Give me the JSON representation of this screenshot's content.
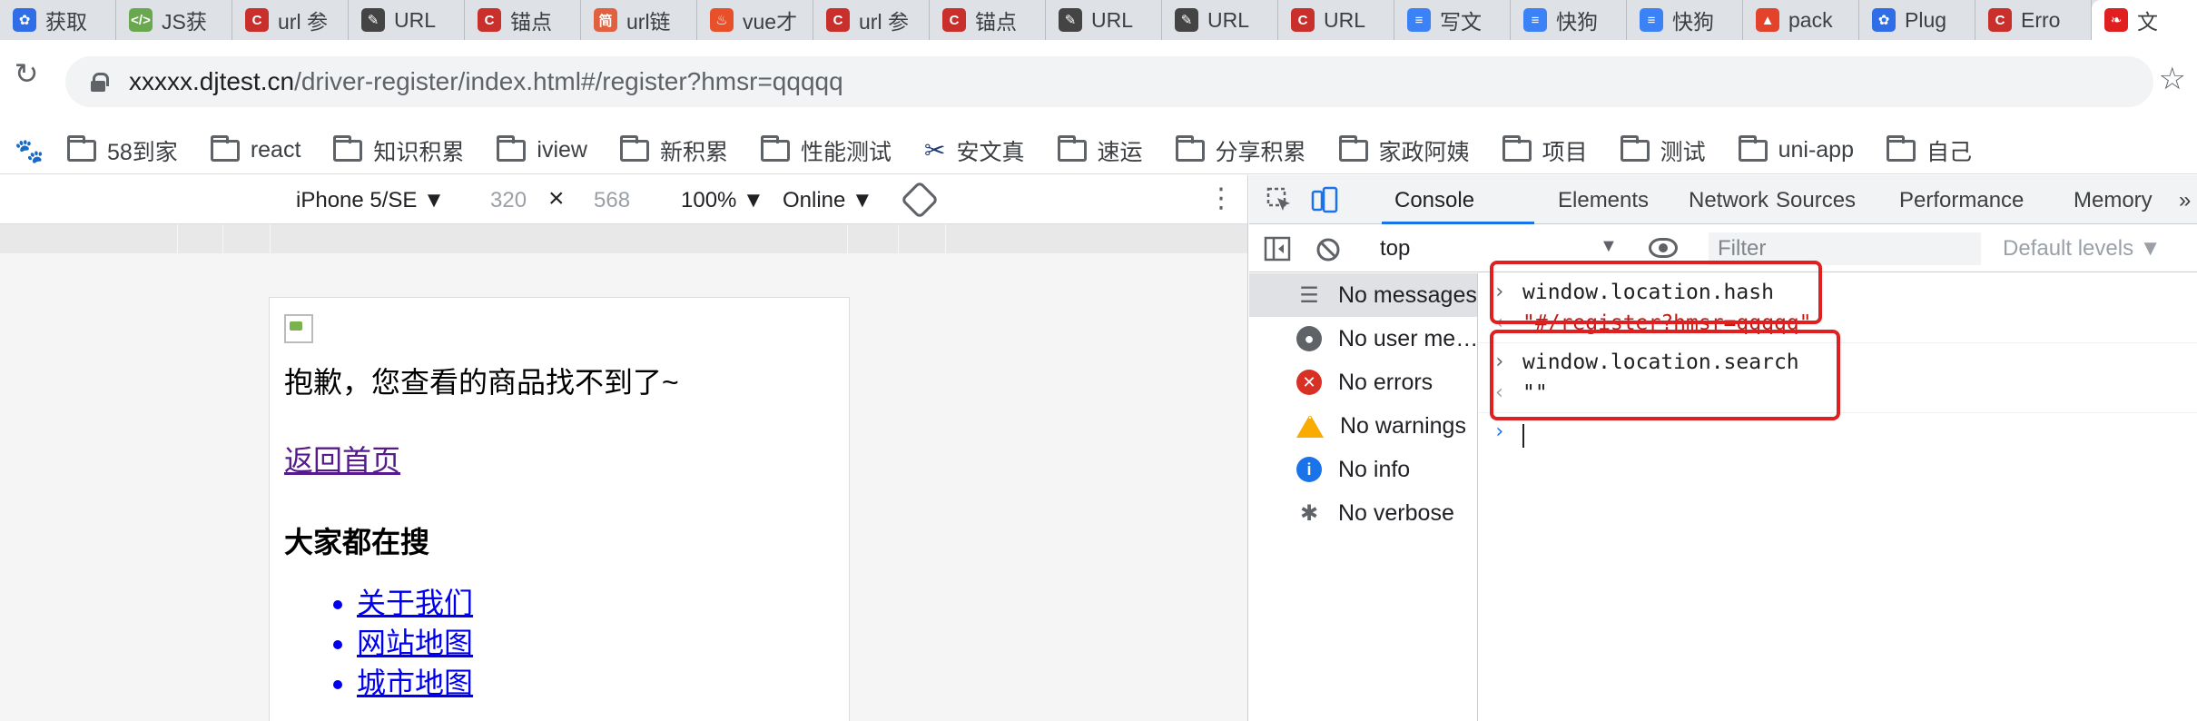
{
  "tabs": [
    {
      "title": "获取",
      "icon": "paw-icon",
      "color": "#2f6ee6"
    },
    {
      "title": "JS获",
      "icon": "code-icon",
      "color": "#6aa84f"
    },
    {
      "title": "url 参",
      "icon": "c-icon",
      "color": "#c9302c"
    },
    {
      "title": "URL",
      "icon": "pen-icon",
      "color": "#444444"
    },
    {
      "title": "锚点",
      "icon": "c-icon",
      "color": "#c9302c"
    },
    {
      "title": "url链",
      "icon": "jian-icon",
      "color": "#e06040"
    },
    {
      "title": "vue才",
      "icon": "flame-icon",
      "color": "#e8502a"
    },
    {
      "title": "url 参",
      "icon": "c-icon",
      "color": "#c9302c"
    },
    {
      "title": "锚点",
      "icon": "c-icon",
      "color": "#c9302c"
    },
    {
      "title": "URL",
      "icon": "pen-icon",
      "color": "#444444"
    },
    {
      "title": "URL",
      "icon": "pen-icon",
      "color": "#444444"
    },
    {
      "title": "URL",
      "icon": "c-icon",
      "color": "#c9302c"
    },
    {
      "title": "写文",
      "icon": "wing-icon",
      "color": "#3b82f6"
    },
    {
      "title": "快狗",
      "icon": "wing-icon",
      "color": "#3b82f6"
    },
    {
      "title": "快狗",
      "icon": "wing-icon",
      "color": "#3b82f6"
    },
    {
      "title": "pack",
      "icon": "fox-icon",
      "color": "#e2432a"
    },
    {
      "title": "Plug",
      "icon": "paw-icon",
      "color": "#2f6ee6"
    },
    {
      "title": "Erro",
      "icon": "c-icon",
      "color": "#c9302c"
    },
    {
      "title": "文",
      "icon": "swan-icon",
      "color": "#e02020"
    }
  ],
  "address": {
    "host": "xxxxx.djtest.cn",
    "path": "/driver-register/index.html#/register?hmsr=qqqqq"
  },
  "bookmarks": [
    {
      "label": "58到家",
      "icon": "folder-icon"
    },
    {
      "label": "react",
      "icon": "folder-icon"
    },
    {
      "label": "知识积累",
      "icon": "folder-icon"
    },
    {
      "label": "iview",
      "icon": "folder-icon"
    },
    {
      "label": "新积累",
      "icon": "folder-icon"
    },
    {
      "label": "性能测试",
      "icon": "folder-icon"
    },
    {
      "label": "安文真",
      "icon": "scissors-icon"
    },
    {
      "label": "速运",
      "icon": "folder-icon"
    },
    {
      "label": "分享积累",
      "icon": "folder-icon"
    },
    {
      "label": "家政阿姨",
      "icon": "folder-icon"
    },
    {
      "label": "项目",
      "icon": "folder-icon"
    },
    {
      "label": "测试",
      "icon": "folder-icon"
    },
    {
      "label": "uni-app",
      "icon": "folder-icon"
    },
    {
      "label": "自己",
      "icon": "folder-icon"
    }
  ],
  "device": {
    "name": "iPhone 5/SE ▼",
    "width": "320",
    "times": "×",
    "height": "568",
    "zoom": "100% ▼",
    "network": "Online ▼"
  },
  "page": {
    "message": "抱歉，您查看的商品找不到了~",
    "back_link": "返回首页",
    "heading": "大家都在搜",
    "links": [
      "关于我们",
      "网站地图",
      "城市地图"
    ]
  },
  "devtools": {
    "tabs": [
      "Console",
      "Elements",
      "Network",
      "Sources",
      "Performance",
      "Memory"
    ],
    "more": "»",
    "context": "top",
    "filter_placeholder": "Filter",
    "levels": "Default levels ▼",
    "sidebar": [
      {
        "label": "No messages",
        "icon": "list-icon",
        "color": "#5f6368"
      },
      {
        "label": "No user me…",
        "icon": "user-icon",
        "color": "#5f6368"
      },
      {
        "label": "No errors",
        "icon": "error-icon",
        "color": "#d93025"
      },
      {
        "label": "No warnings",
        "icon": "warning-icon",
        "color": "#f9ab00"
      },
      {
        "label": "No info",
        "icon": "info-icon",
        "color": "#1a73e8"
      },
      {
        "label": "No verbose",
        "icon": "bug-icon",
        "color": "#5f6368"
      }
    ],
    "console": [
      {
        "input": "window.location.hash",
        "output": "\"#/register?hmsr=qqqqq\""
      },
      {
        "input": "window.location.search",
        "output": "\"\""
      }
    ]
  }
}
